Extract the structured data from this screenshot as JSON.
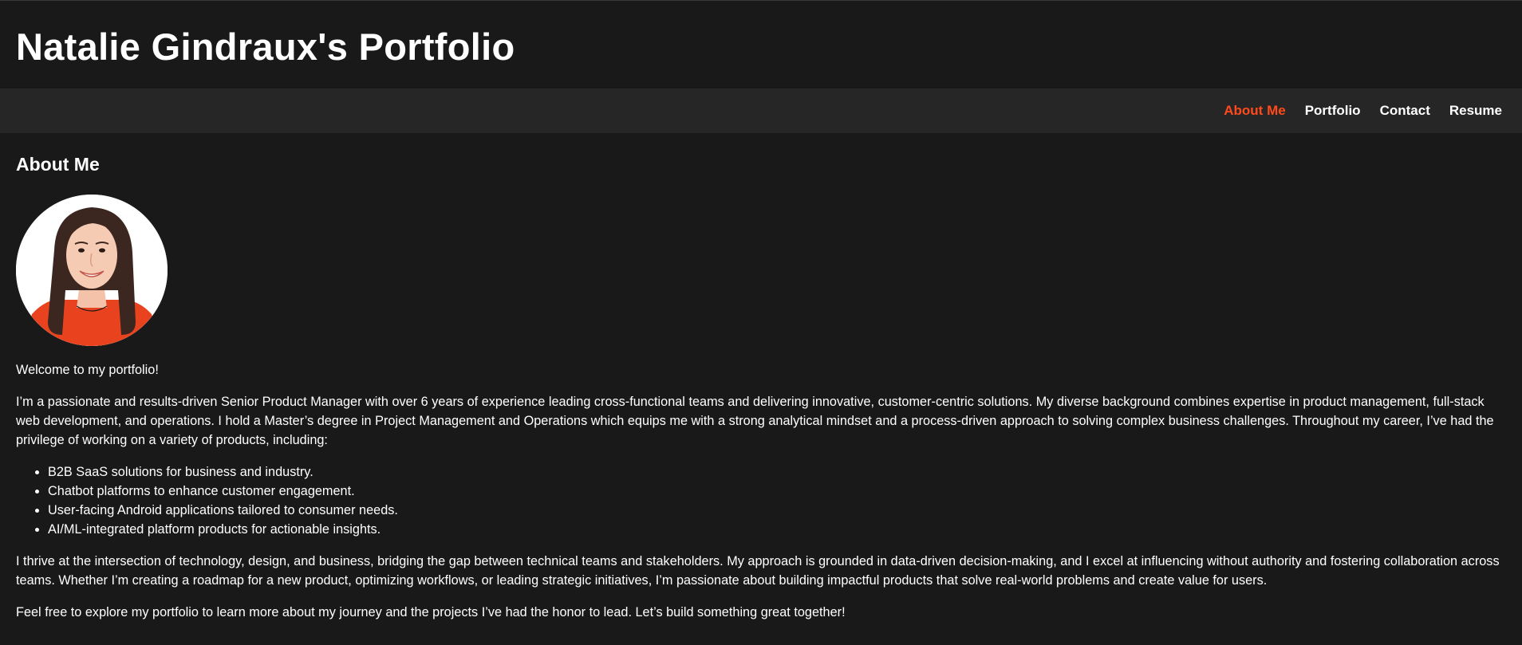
{
  "header": {
    "title": "Natalie Gindraux's Portfolio"
  },
  "nav": {
    "items": [
      {
        "label": "About Me",
        "active": true
      },
      {
        "label": "Portfolio",
        "active": false
      },
      {
        "label": "Contact",
        "active": false
      },
      {
        "label": "Resume",
        "active": false
      }
    ]
  },
  "about": {
    "heading": "About Me",
    "avatar_icon": "profile-photo",
    "welcome": "Welcome to my portfolio!",
    "intro": "I’m a passionate and results-driven Senior Product Manager with over 6 years of experience leading cross-functional teams and delivering innovative, customer-centric solutions. My diverse background combines expertise in product management, full-stack web development, and operations. I hold a Master’s degree in Project Management and Operations which equips me with a strong analytical mindset and a process-driven approach to solving complex business challenges. Throughout my career, I’ve had the privilege of working on a variety of products, including:",
    "products": [
      "B2B SaaS solutions for business and industry.",
      "Chatbot platforms to enhance customer engagement.",
      "User-facing Android applications tailored to consumer needs.",
      "AI/ML-integrated platform products for actionable insights."
    ],
    "approach": "I thrive at the intersection of technology, design, and business, bridging the gap between technical teams and stakeholders. My approach is grounded in data-driven decision-making, and I excel at influencing without authority and fostering collaboration across teams. Whether I’m creating a roadmap for a new product, optimizing workflows, or leading strategic initiatives, I’m passionate about building impactful products that solve real-world problems and create value for users.",
    "closing": "Feel free to explore my portfolio to learn more about my journey and the projects I’ve had the honor to lead. Let’s build something great together!"
  },
  "colors": {
    "background": "#191919",
    "nav_background": "#262626",
    "accent": "#ff4a1c",
    "text": "#ffffff"
  }
}
